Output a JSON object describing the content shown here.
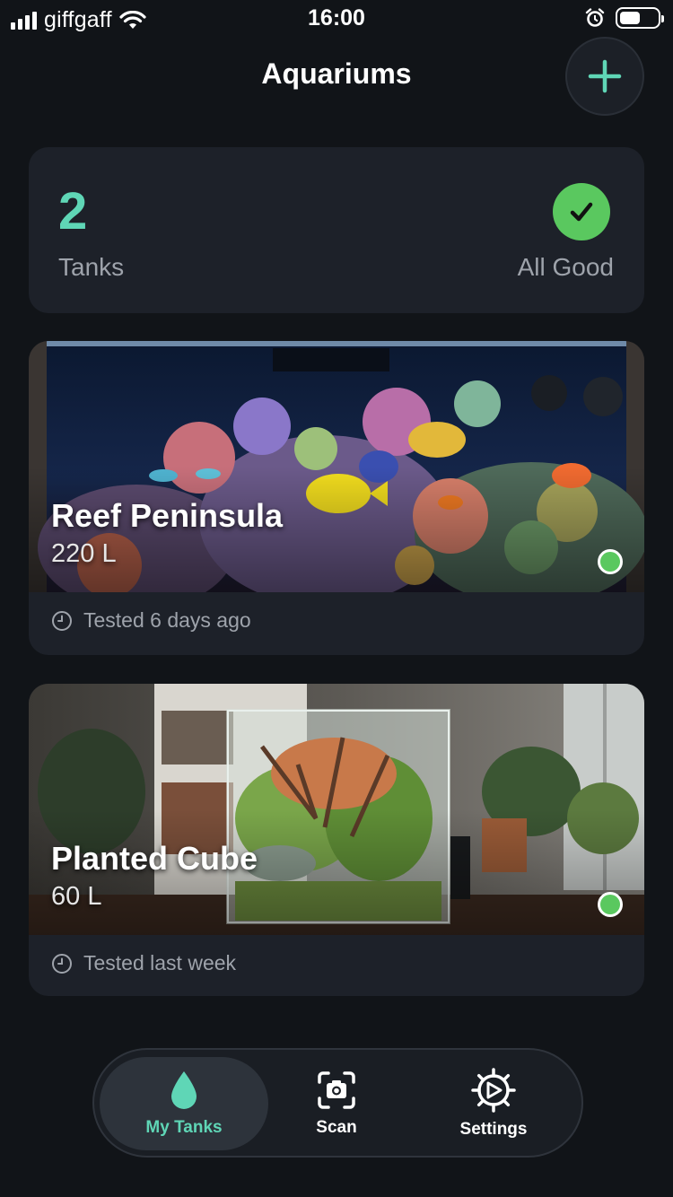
{
  "status_bar": {
    "carrier": "giffgaff",
    "time": "16:00"
  },
  "header": {
    "title": "Aquariums",
    "add_icon": "plus-icon"
  },
  "summary": {
    "count": "2",
    "count_label": "Tanks",
    "status_text": "All Good",
    "status_icon": "checkmark-icon",
    "status_color": "#5ac85f"
  },
  "tanks": [
    {
      "name": "Reef Peninsula",
      "volume": "220 L",
      "tested": "Tested 6 days ago",
      "status_color": "#5ac85f"
    },
    {
      "name": "Planted Cube",
      "volume": "60 L",
      "tested": "Tested last week",
      "status_color": "#5ac85f"
    }
  ],
  "nav": {
    "items": [
      {
        "label": "My Tanks",
        "icon": "water-drop-icon",
        "active": true
      },
      {
        "label": "Scan",
        "icon": "camera-scan-icon",
        "active": false
      },
      {
        "label": "Settings",
        "icon": "gear-icon",
        "active": false
      }
    ]
  },
  "colors": {
    "accent": "#5fd6b6",
    "background": "#111418",
    "card": "#1d2129"
  }
}
